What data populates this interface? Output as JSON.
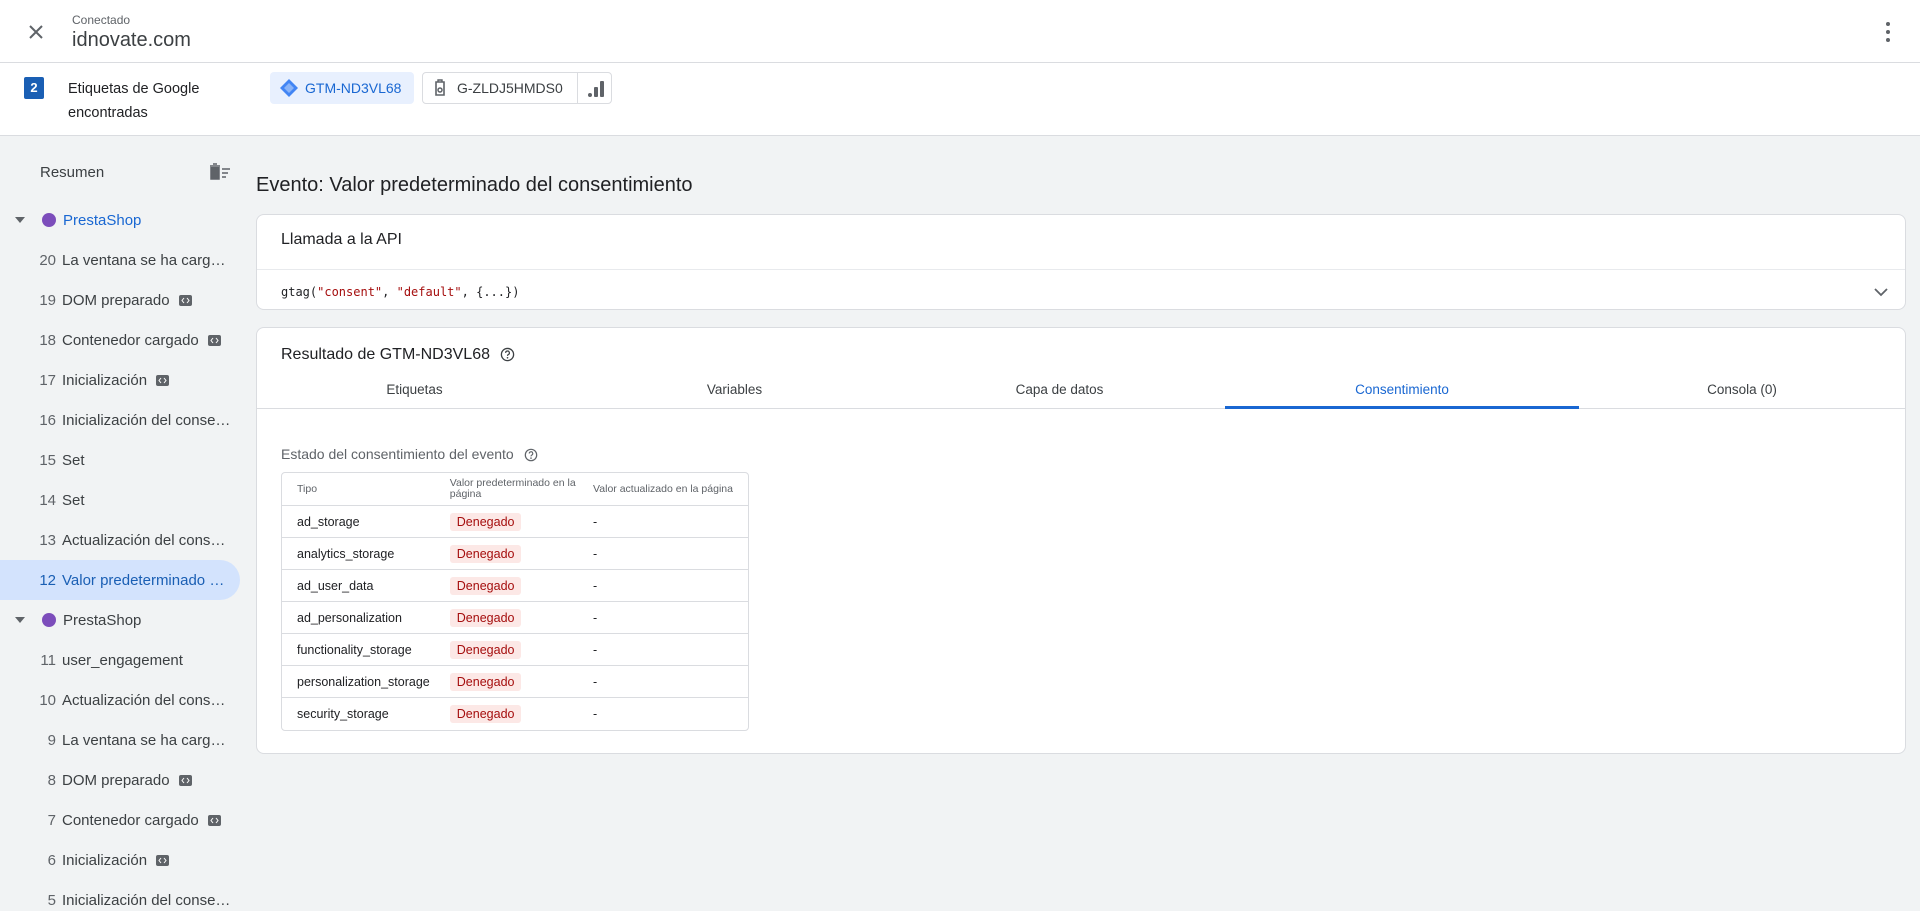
{
  "header": {
    "status": "Conectado",
    "domain": "idnovate.com"
  },
  "tagbar": {
    "count": "2",
    "label": "Etiquetas de Google encontradas",
    "chips": [
      {
        "id": "GTM-ND3VL68"
      },
      {
        "id": "G-ZLDJ5HMDS0"
      }
    ]
  },
  "sidebar": {
    "summary": "Resumen",
    "groups": [
      {
        "name": "PrestaShop",
        "items": [
          {
            "num": "20",
            "label": "La ventana se ha cargado"
          },
          {
            "num": "19",
            "label": "DOM preparado",
            "code": true
          },
          {
            "num": "18",
            "label": "Contenedor cargado",
            "code": true
          },
          {
            "num": "17",
            "label": "Inicialización",
            "code": true
          },
          {
            "num": "16",
            "label": "Inicialización del consentimiento"
          },
          {
            "num": "15",
            "label": "Set"
          },
          {
            "num": "14",
            "label": "Set"
          },
          {
            "num": "13",
            "label": "Actualización del consentimiento"
          },
          {
            "num": "12",
            "label": "Valor predeterminado del consentimiento",
            "selected": true
          }
        ]
      },
      {
        "name": "PrestaShop",
        "items": [
          {
            "num": "11",
            "label": "user_engagement"
          },
          {
            "num": "10",
            "label": "Actualización del consentimiento"
          },
          {
            "num": "9",
            "label": "La ventana se ha cargado"
          },
          {
            "num": "8",
            "label": "DOM preparado",
            "code": true
          },
          {
            "num": "7",
            "label": "Contenedor cargado",
            "code": true
          },
          {
            "num": "6",
            "label": "Inicialización",
            "code": true
          },
          {
            "num": "5",
            "label": "Inicialización del consentimiento"
          }
        ]
      }
    ]
  },
  "main": {
    "title": "Evento: Valor predeterminado del consentimiento",
    "api": {
      "title": "Llamada a la API",
      "code": {
        "fn": "gtag(",
        "arg1": "\"consent\"",
        "sep": ", ",
        "arg2": "\"default\"",
        "rest": ", {...})"
      }
    },
    "result": {
      "title": "Resultado de GTM-ND3VL68",
      "tabs": [
        "Etiquetas",
        "Variables",
        "Capa de datos",
        "Consentimiento",
        "Consola (0)"
      ],
      "active_tab": 3,
      "consent": {
        "title": "Estado del consentimiento del evento",
        "headers": [
          "Tipo",
          "Valor predeterminado en la página",
          "Valor actualizado en la página"
        ],
        "rows": [
          {
            "type": "ad_storage",
            "default": "Denegado",
            "updated": "-"
          },
          {
            "type": "analytics_storage",
            "default": "Denegado",
            "updated": "-"
          },
          {
            "type": "ad_user_data",
            "default": "Denegado",
            "updated": "-"
          },
          {
            "type": "ad_personalization",
            "default": "Denegado",
            "updated": "-"
          },
          {
            "type": "functionality_storage",
            "default": "Denegado",
            "updated": "-"
          },
          {
            "type": "personalization_storage",
            "default": "Denegado",
            "updated": "-"
          },
          {
            "type": "security_storage",
            "default": "Denegado",
            "updated": "-"
          }
        ]
      }
    }
  },
  "colors": {
    "accent": "#1967d2",
    "selected_bg": "#d3e3fd",
    "denied_bg": "#fce8e6",
    "denied_text": "#a50e0e",
    "group_dot": "#7c4dbb"
  }
}
